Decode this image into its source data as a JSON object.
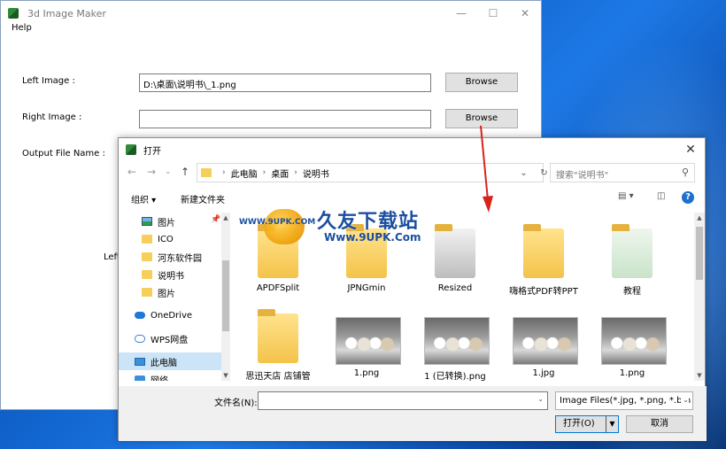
{
  "main_window": {
    "title": "3d Image Maker",
    "menu": [
      "Help"
    ],
    "left_label": "Left Image :",
    "left_value": "D:\\桌面\\说明书\\_1.png",
    "right_label": "Right Image :",
    "right_value": "",
    "output_label": "Output File Name :",
    "browse_label": "Browse",
    "partial_label": "Left"
  },
  "dialog": {
    "title": "打开",
    "path": [
      "此电脑",
      "桌面",
      "说明书"
    ],
    "search_placeholder": "搜索\"说明书\"",
    "toolbar": {
      "organize": "组织 ▾",
      "new_folder": "新建文件夹"
    },
    "nav_items": [
      {
        "label": "图片",
        "icon": "pictures-icon",
        "pinned": true
      },
      {
        "label": "ICO",
        "icon": "folder-icon"
      },
      {
        "label": "河东软件园",
        "icon": "folder-icon"
      },
      {
        "label": "说明书",
        "icon": "folder-icon"
      },
      {
        "label": "图片",
        "icon": "folder-icon"
      },
      {
        "label": "OneDrive",
        "icon": "onedrive-icon"
      },
      {
        "label": "WPS网盘",
        "icon": "wps-cloud-icon"
      },
      {
        "label": "此电脑",
        "icon": "this-pc-icon",
        "selected": true
      },
      {
        "label": "网络",
        "icon": "network-icon"
      }
    ],
    "files": [
      {
        "name": "APDFSplit",
        "kind": "folder"
      },
      {
        "name": "JPNGmin",
        "kind": "folder"
      },
      {
        "name": "Resized",
        "kind": "folder"
      },
      {
        "name": "嗨格式PDF转PPT",
        "kind": "folder"
      },
      {
        "name": "教程",
        "kind": "folder"
      },
      {
        "name": "思迅天店 店铺管",
        "kind": "folder"
      },
      {
        "name": "1.png",
        "kind": "image"
      },
      {
        "name": "1 (已转换).png",
        "kind": "image"
      },
      {
        "name": "1.jpg",
        "kind": "image"
      },
      {
        "name": "1.png",
        "kind": "image"
      }
    ],
    "filename_label": "文件名(N):",
    "filename_value": "",
    "filter_value": "Image Files(*.jpg, *.png, *.bm",
    "open_label": "打开(O)",
    "cancel_label": "取消"
  },
  "watermark": {
    "brand": "久友下载站",
    "url": "Www.9UPK.Com",
    "url_left": "WWW.9UPK.COM"
  },
  "colors": {
    "accent": "#0078d7",
    "arrow": "#d8231d",
    "selection": "#cce4f7"
  }
}
